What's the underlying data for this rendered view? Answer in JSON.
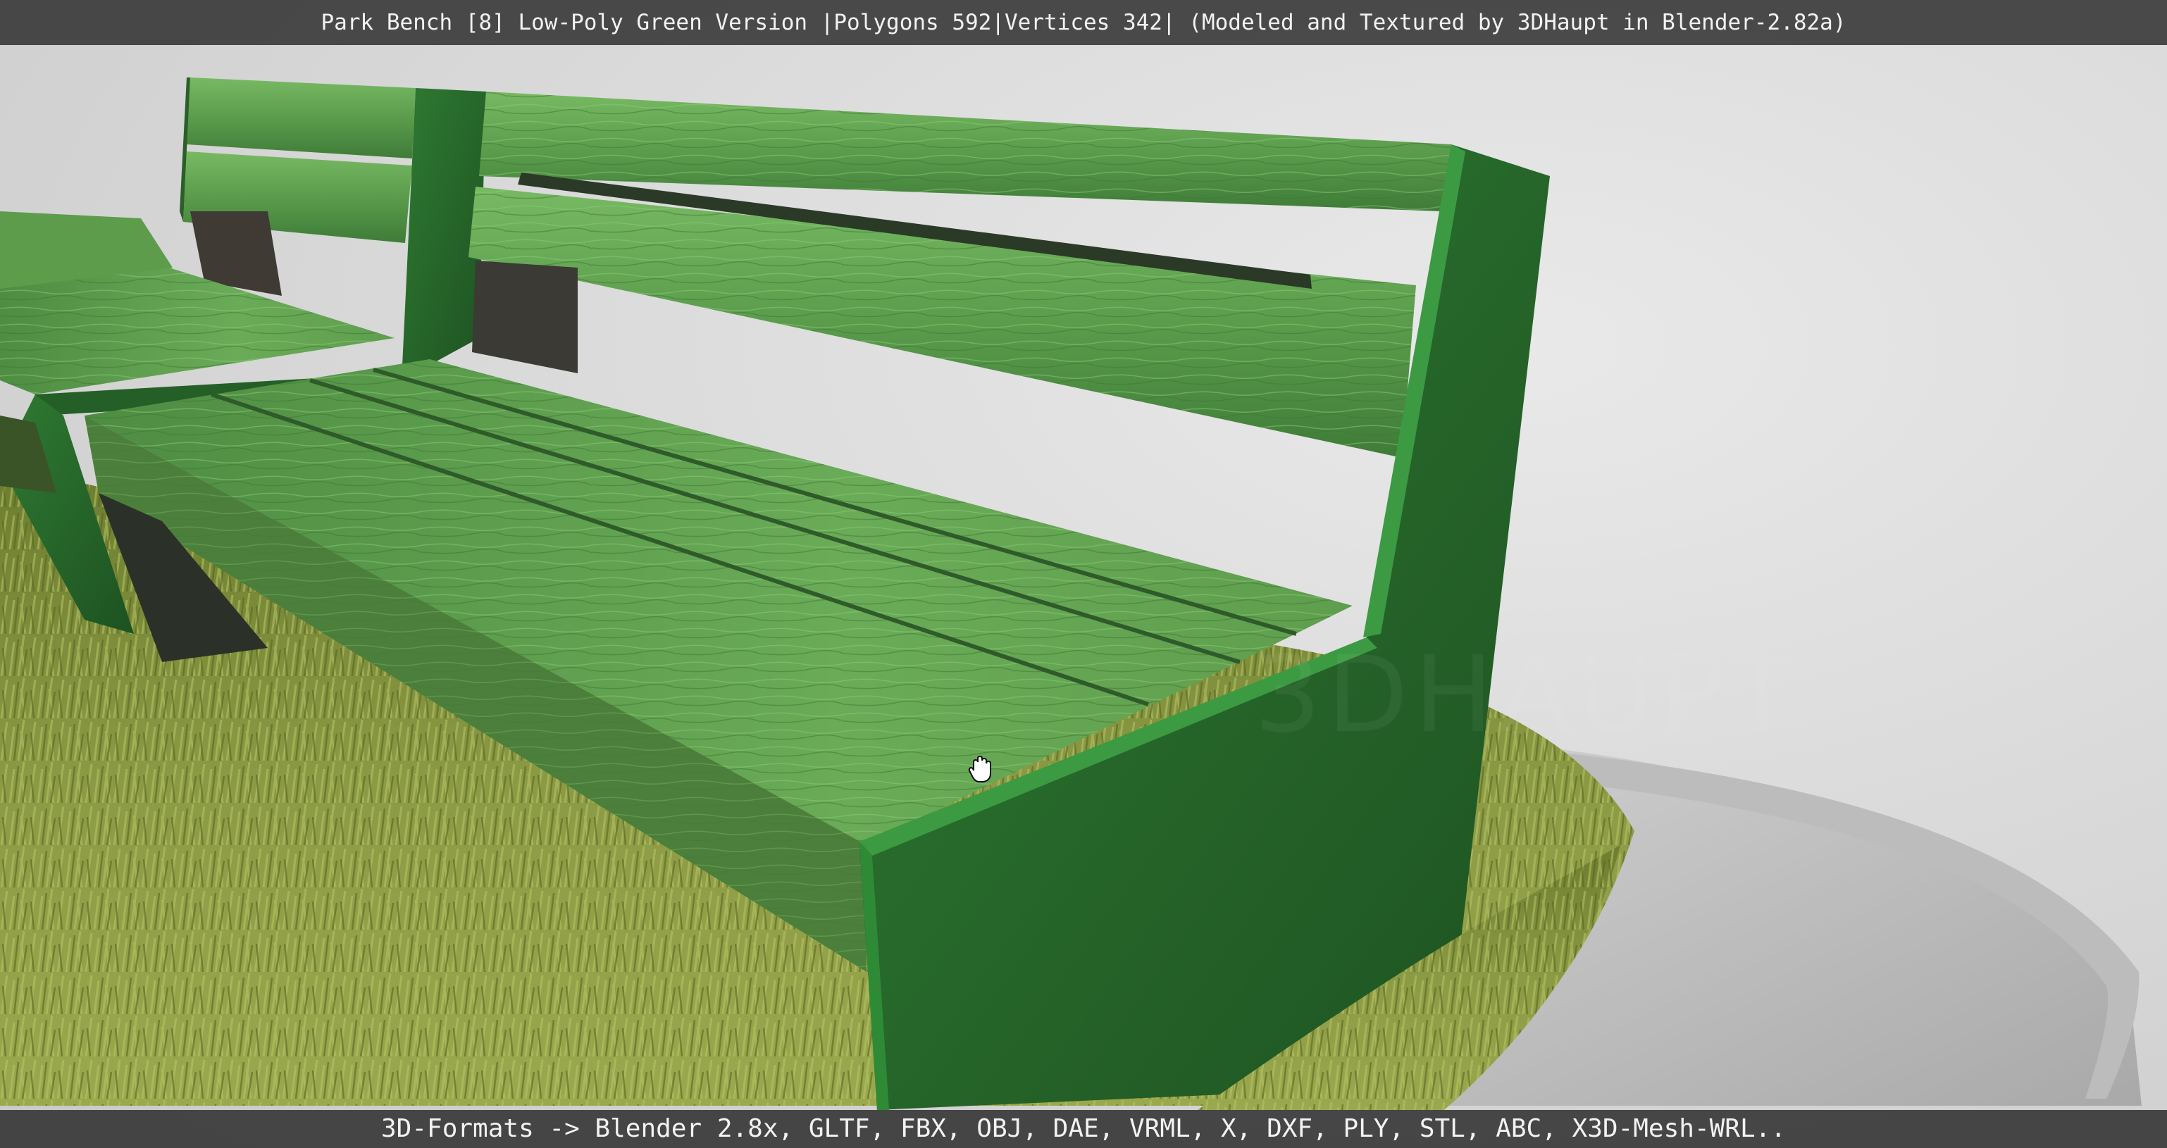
{
  "viewer": {
    "title": "Park Bench [8] Low-Poly Green Version |Polygons 592|Vertices 342| (Modeled and Textured by 3DHaupt in Blender-2.82a)",
    "formats": "3D-Formats -> Blender 2.8x, GLTF, FBX, OBJ, DAE, VRML, X, DXF, PLY, STL, ABC, X3D-Mesh-WRL..",
    "cursor_icon": "hand-grab-icon"
  },
  "colors": {
    "frame_green": "#2a6e2e",
    "frame_dark": "#1f5a23",
    "slat_green": "#4f9444",
    "slat_light": "#6fb25c",
    "grass": "#7f8f3a",
    "platform": "#bdbdbd",
    "bar_bg": "#2d2d2d"
  }
}
